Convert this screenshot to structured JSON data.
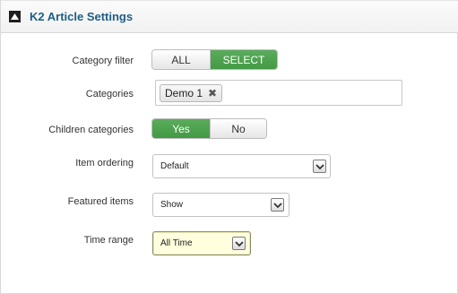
{
  "panel": {
    "title": "K2 Article Settings",
    "icon": "collapse-triangle-icon"
  },
  "fields": {
    "category_filter": {
      "label": "Category filter",
      "options": [
        "ALL",
        "SELECT"
      ],
      "selected": "SELECT"
    },
    "categories": {
      "label": "Categories",
      "tags": [
        {
          "text": "Demo 1",
          "remove_glyph": "✖"
        }
      ]
    },
    "children_categories": {
      "label": "Children categories",
      "options": [
        "Yes",
        "No"
      ],
      "selected": "Yes"
    },
    "item_ordering": {
      "label": "Item ordering",
      "value": "Default"
    },
    "featured_items": {
      "label": "Featured items",
      "value": "Show"
    },
    "time_range": {
      "label": "Time range",
      "value": "All Time"
    }
  },
  "colors": {
    "title": "#1f5d84",
    "active_toggle": "#4aa04b",
    "highlight_select": "#ffffdd"
  }
}
